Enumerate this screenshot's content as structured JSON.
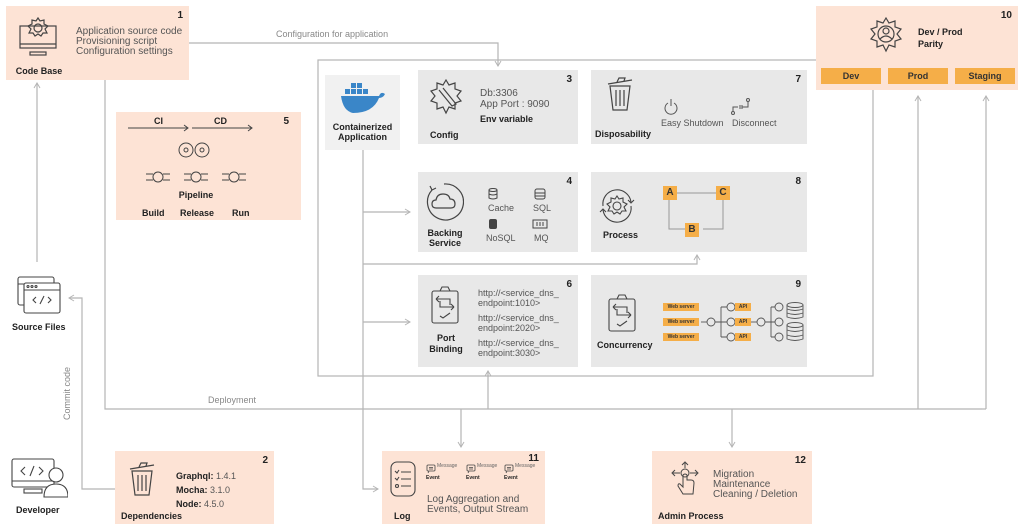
{
  "colors": {
    "salmon": "#fde3d5",
    "gray": "#e8e8e8",
    "orange": "#f5ae48",
    "line": "#b5b5b5",
    "docker": "#3a86c8"
  },
  "connectors": {
    "config_for_app": "Configuration for application",
    "deployment": "Deployment",
    "commit_code": "Commit code"
  },
  "codebase": {
    "num": "1",
    "title": "Code Base",
    "lines": [
      "Application source code",
      "Provisioning script",
      "Configuration settings"
    ]
  },
  "dependencies": {
    "num": "2",
    "title": "Dependencies",
    "items": [
      {
        "name": "Graphql:",
        "version": "1.4.1"
      },
      {
        "name": "Mocha:",
        "version": "3.1.0"
      },
      {
        "name": "Node:",
        "version": "4.5.0"
      }
    ]
  },
  "config": {
    "num": "3",
    "title": "Config",
    "lines": [
      "Db:3306",
      "App Port : 9090"
    ],
    "bold_line": "Env variable"
  },
  "backing": {
    "num": "4",
    "title": "Backing Service",
    "items": [
      "Cache",
      "SQL",
      "NoSQL",
      "MQ"
    ]
  },
  "pipeline": {
    "num": "5",
    "ci": "CI",
    "cd": "CD",
    "title": "Pipeline",
    "stages": [
      "Build",
      "Release",
      "Run"
    ]
  },
  "port": {
    "num": "6",
    "title": "Port Binding",
    "endpoints": [
      [
        "http://<service_dns_",
        "endpoint:1010>"
      ],
      [
        "http://<service_dns_",
        "endpoint:2020>"
      ],
      [
        "http://<service_dns_",
        "endpoint:3030>"
      ]
    ]
  },
  "disposability": {
    "num": "7",
    "title": "Disposability",
    "items": [
      "Easy Shutdown",
      "Disconnect"
    ]
  },
  "process": {
    "num": "8",
    "title": "Process",
    "nodes": [
      "A",
      "B",
      "C"
    ]
  },
  "concurrency": {
    "num": "9",
    "title": "Concurrency",
    "web": [
      "Web server",
      "Web server",
      "Web server"
    ],
    "api": [
      "API",
      "API",
      "API"
    ]
  },
  "parity": {
    "num": "10",
    "title_line1": "Dev / Prod",
    "title_line2": "Parity",
    "envs": [
      "Dev",
      "Prod",
      "Staging"
    ]
  },
  "logs": {
    "num": "11",
    "title": "Log",
    "events": [
      {
        "msg": "Message",
        "evt": "Event"
      },
      {
        "msg": "Message",
        "evt": "Event"
      },
      {
        "msg": "Message",
        "evt": "Event"
      }
    ],
    "desc": [
      "Log Aggregation and",
      "Events, Output Stream"
    ]
  },
  "admin": {
    "num": "12",
    "title": "Admin Process",
    "lines": [
      "Migration",
      "Maintenance",
      "Cleaning / Deletion"
    ]
  },
  "container": {
    "title_line1": "Containerized",
    "title_line2": "Application"
  },
  "source_files": {
    "title": "Source Files"
  },
  "developer": {
    "title": "Developer"
  }
}
